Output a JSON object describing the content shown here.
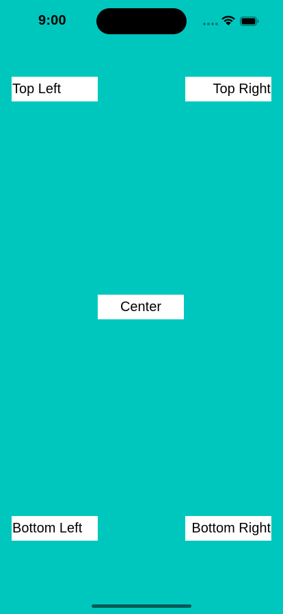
{
  "status_bar": {
    "time": "9:00",
    "icons": [
      "cellular-signal-icon",
      "wifi-icon",
      "battery-icon"
    ]
  },
  "colors": {
    "background": "#00C7BE",
    "label_background": "#FFFFFF",
    "text": "#000000"
  },
  "labels": {
    "top_left": "Top Left",
    "top_right": "Top Right",
    "center": "Center",
    "bottom_left": "Bottom Left",
    "bottom_right": "Bottom Right"
  }
}
